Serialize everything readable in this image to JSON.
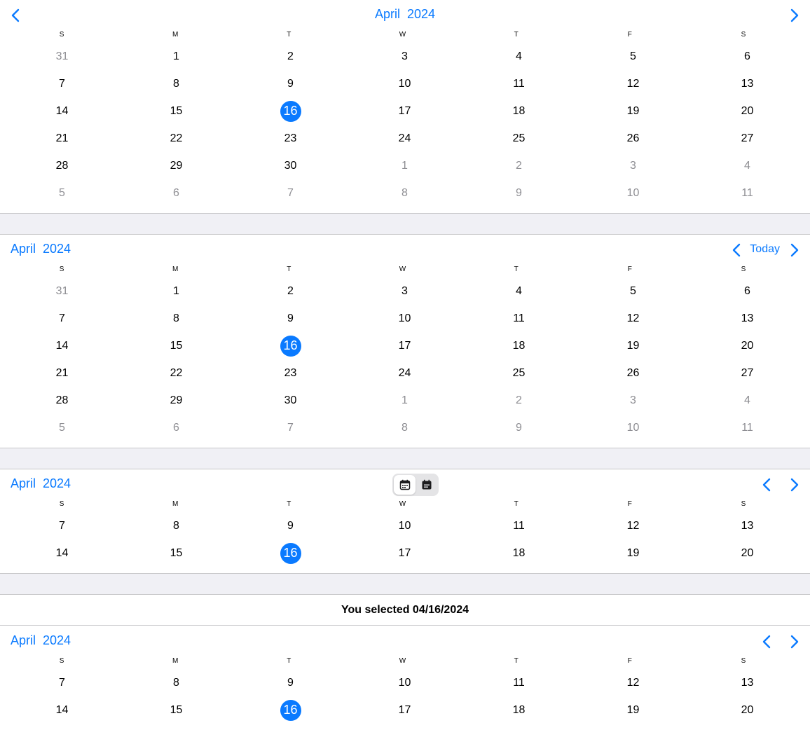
{
  "accent_color": "#0a7aff",
  "weekday_labels": [
    "S",
    "M",
    "T",
    "W",
    "T",
    "F",
    "S"
  ],
  "calendar1": {
    "title": "April  2024",
    "prev_icon": "chevron-left-icon",
    "next_icon": "chevron-right-icon",
    "rows": [
      [
        "31",
        "1",
        "2",
        "3",
        "4",
        "5",
        "6"
      ],
      [
        "7",
        "8",
        "9",
        "10",
        "11",
        "12",
        "13"
      ],
      [
        "14",
        "15",
        "16",
        "17",
        "18",
        "19",
        "20"
      ],
      [
        "21",
        "22",
        "23",
        "24",
        "25",
        "26",
        "27"
      ],
      [
        "28",
        "29",
        "30",
        "1",
        "2",
        "3",
        "4"
      ],
      [
        "5",
        "6",
        "7",
        "8",
        "9",
        "10",
        "11"
      ]
    ],
    "selected": "16"
  },
  "calendar2": {
    "title": "April  2024",
    "today_label": "Today",
    "rows": [
      [
        "31",
        "1",
        "2",
        "3",
        "4",
        "5",
        "6"
      ],
      [
        "7",
        "8",
        "9",
        "10",
        "11",
        "12",
        "13"
      ],
      [
        "14",
        "15",
        "16",
        "17",
        "18",
        "19",
        "20"
      ],
      [
        "21",
        "22",
        "23",
        "24",
        "25",
        "26",
        "27"
      ],
      [
        "28",
        "29",
        "30",
        "1",
        "2",
        "3",
        "4"
      ],
      [
        "5",
        "6",
        "7",
        "8",
        "9",
        "10",
        "11"
      ]
    ],
    "selected": "16"
  },
  "calendar3": {
    "title": "April  2024",
    "segment_icons": [
      "calendar-month-icon",
      "calendar-week-icon"
    ],
    "rows": [
      [
        "7",
        "8",
        "9",
        "10",
        "11",
        "12",
        "13"
      ],
      [
        "14",
        "15",
        "16",
        "17",
        "18",
        "19",
        "20"
      ]
    ],
    "selected": "16"
  },
  "selection_text": "You selected 04/16/2024",
  "calendar4": {
    "title": "April  2024",
    "rows": [
      [
        "7",
        "8",
        "9",
        "10",
        "11",
        "12",
        "13"
      ],
      [
        "14",
        "15",
        "16",
        "17",
        "18",
        "19",
        "20"
      ]
    ],
    "selected": "16"
  }
}
